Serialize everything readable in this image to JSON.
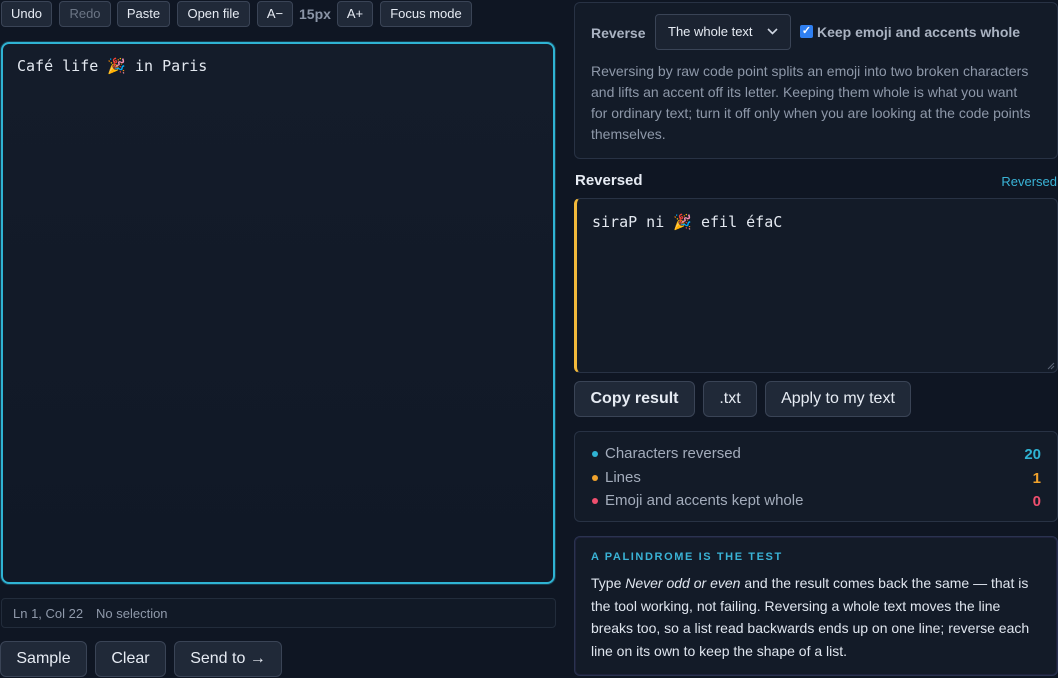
{
  "toolbar": {
    "undo": "Undo",
    "redo": "Redo",
    "paste": "Paste",
    "open_file": "Open file",
    "font_down": "A−",
    "font_size": "15px",
    "font_up": "A+",
    "focus_mode": "Focus mode"
  },
  "editor": {
    "text": "Café life 🎉 in Paris"
  },
  "status": {
    "position": "Ln 1, Col 22",
    "selection": "No selection"
  },
  "bottom_actions": {
    "sample": "Sample",
    "clear": "Clear",
    "send_to": "Send to →"
  },
  "options": {
    "reverse_label": "Reverse",
    "reverse_mode": "The whole text",
    "keep_whole_label": "Keep emoji and accents whole",
    "keep_whole_checked": true,
    "explanation": "Reversing by raw code point splits an emoji into two broken characters and lifts an accent off its letter. Keeping them whole is what you want for ordinary text; turn it off only when you are looking at the code points themselves."
  },
  "result": {
    "title": "Reversed",
    "tag": "Reversed",
    "text": "siraP ni 🎉 efil éfaC",
    "copy": "Copy result",
    "txt": ".txt",
    "apply": "Apply to my text"
  },
  "stats": [
    {
      "label": "Characters reversed",
      "value": "20",
      "color": "#2fb3d3"
    },
    {
      "label": "Lines",
      "value": "1",
      "color": "#f0a22c"
    },
    {
      "label": "Emoji and accents kept whole",
      "value": "0",
      "color": "#ef4f6e"
    }
  ],
  "note": {
    "heading": "A PALINDROME IS THE TEST",
    "body_prefix": "Type ",
    "body_example": "Never odd or even",
    "body_rest": " and the result comes back the same — that is the tool working, not failing. Reversing a whole text moves the line breaks too, so a list read backwards ends up on one line; reverse each line on its own to keep the shape of a list."
  }
}
